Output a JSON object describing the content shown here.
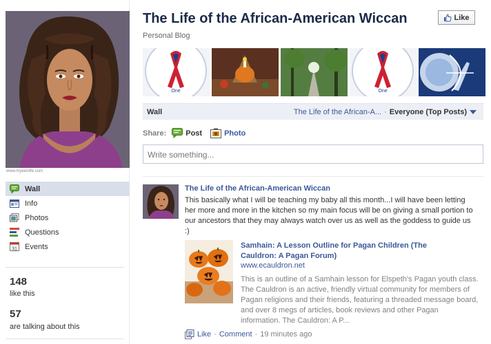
{
  "page": {
    "title": "The Life of the African-American Wiccan",
    "category": "Personal Blog",
    "like_button": "Like",
    "watermark": "www.myeenlife.com"
  },
  "nav": {
    "items": [
      {
        "label": "Wall",
        "icon": "wall-icon",
        "active": true
      },
      {
        "label": "Info",
        "icon": "info-icon"
      },
      {
        "label": "Photos",
        "icon": "photos-icon"
      },
      {
        "label": "Questions",
        "icon": "questions-icon"
      },
      {
        "label": "Events",
        "icon": "events-icon",
        "icon_text": "31"
      }
    ]
  },
  "stats": {
    "likes_count": "148",
    "likes_label": "like this",
    "talking_count": "57",
    "talking_label": "are talking about this"
  },
  "photo_strip": {
    "ribbon_text": "One"
  },
  "wall": {
    "label": "Wall",
    "filter_link": "The Life of the African-A...",
    "filter_separator": "·",
    "filter_selected": "Everyone (Top Posts)"
  },
  "share": {
    "label": "Share:",
    "post": "Post",
    "photo": "Photo"
  },
  "composer": {
    "placeholder": "Write something..."
  },
  "story": {
    "author": "The Life of the African-American Wiccan",
    "text": "This basically what I will be teaching my baby all this month...I will have been letting her more and more in the kitchen so my main focus will be on giving a small portion to our ancestors that they may always watch over us as well as the goddess to guide us :)",
    "attachment": {
      "title": "Samhain: A Lesson Outline for Pagan Children (The Cauldron: A Pagan Forum)",
      "url": "www.ecauldron.net",
      "description": "This is an outline of a Samhain lesson for Elspeth's Pagan youth class. The Cauldron is an active, friendly virtual community for members of Pagan religions and their friends, featuring a threaded message board, and over 8 megs of articles, book reviews and other Pagan information. The Cauldron: A P..."
    },
    "footer": {
      "like": "Like",
      "separator": "·",
      "comment": "Comment",
      "time": "19 minutes ago"
    }
  },
  "colors": {
    "link": "#3b5998",
    "title": "#1c2a47",
    "nav_active_bg": "#d8dfea",
    "wallbar_bg": "#eceff5"
  }
}
